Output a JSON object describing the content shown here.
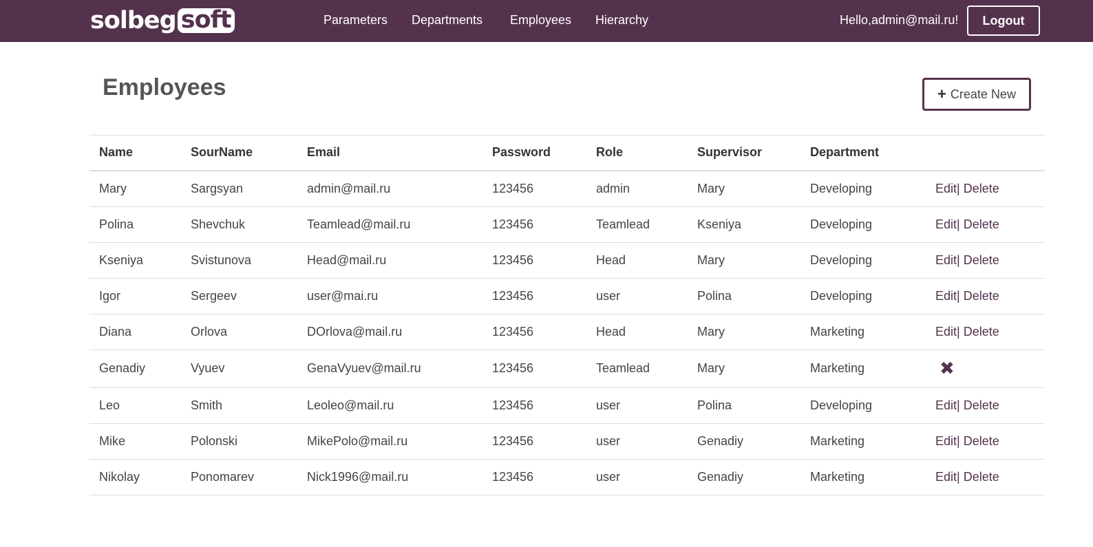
{
  "brand": {
    "logo_a": "solbeg",
    "logo_b": "soft"
  },
  "nav": {
    "items": [
      {
        "label": "Parameters"
      },
      {
        "label": "Departments"
      },
      {
        "label": "Employees"
      },
      {
        "label": "Hierarchy"
      }
    ],
    "greeting": "Hello,admin@mail.ru!",
    "logout_label": "Logout"
  },
  "page": {
    "title": "Employees",
    "create_label": "Create New",
    "create_icon": "plus-icon"
  },
  "table": {
    "headers": [
      "Name",
      "SourName",
      "Email",
      "Password",
      "Role",
      "Supervisor",
      "Department",
      ""
    ],
    "edit_label": "Edit|",
    "delete_label": "Delete",
    "delete_icon_glyph": "✖",
    "rows": [
      {
        "name": "Mary",
        "surname": "Sargsyan",
        "email": "admin@mail.ru",
        "password": "123456",
        "role": "admin",
        "supervisor": "Mary",
        "department": "Developing",
        "action": "links"
      },
      {
        "name": "Polina",
        "surname": "Shevchuk",
        "email": "Teamlead@mail.ru",
        "password": "123456",
        "role": "Teamlead",
        "supervisor": "Kseniya",
        "department": "Developing",
        "action": "links"
      },
      {
        "name": "Kseniya",
        "surname": "Svistunova",
        "email": "Head@mail.ru",
        "password": "123456",
        "role": "Head",
        "supervisor": "Mary",
        "department": "Developing",
        "action": "links"
      },
      {
        "name": "Igor",
        "surname": "Sergeev",
        "email": "user@mai.ru",
        "password": "123456",
        "role": "user",
        "supervisor": "Polina",
        "department": "Developing",
        "action": "links"
      },
      {
        "name": "Diana",
        "surname": "Orlova",
        "email": "DOrlova@mail.ru",
        "password": "123456",
        "role": "Head",
        "supervisor": "Mary",
        "department": "Marketing",
        "action": "links"
      },
      {
        "name": "Genadiy",
        "surname": "Vyuev",
        "email": "GenaVyuev@mail.ru",
        "password": "123456",
        "role": "Teamlead",
        "supervisor": "Mary",
        "department": "Marketing",
        "action": "delete-icon"
      },
      {
        "name": "Leo",
        "surname": "Smith",
        "email": "Leoleo@mail.ru",
        "password": "123456",
        "role": "user",
        "supervisor": "Polina",
        "department": "Developing",
        "action": "links"
      },
      {
        "name": "Mike",
        "surname": "Polonski",
        "email": "MikePolo@mail.ru",
        "password": "123456",
        "role": "user",
        "supervisor": "Genadiy",
        "department": "Marketing",
        "action": "links"
      },
      {
        "name": "Nikolay",
        "surname": "Ponomarev",
        "email": "Nick1996@mail.ru",
        "password": "123456",
        "role": "user",
        "supervisor": "Genadiy",
        "department": "Marketing",
        "action": "links"
      }
    ]
  },
  "colors": {
    "brand": "#54324d",
    "delete_icon": "#e00000"
  }
}
